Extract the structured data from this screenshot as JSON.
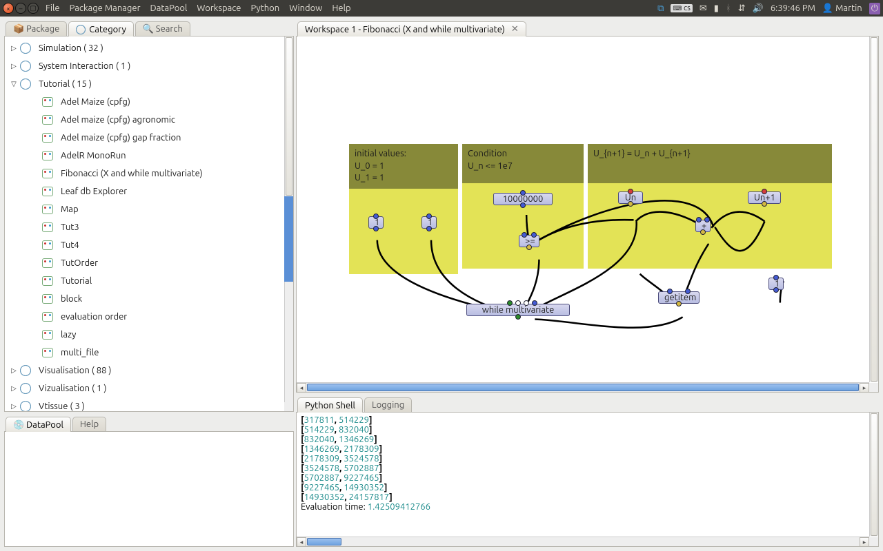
{
  "topbar": {
    "menus": [
      "File",
      "Package Manager",
      "DataPool",
      "Workspace",
      "Python",
      "Window",
      "Help"
    ],
    "clock": "6:39:46 PM",
    "user": "Martin",
    "kbd": "cs"
  },
  "left": {
    "tabs": {
      "package": "Package",
      "category": "Category",
      "search": "Search"
    },
    "tree": {
      "simulation": "Simulation ( 32 )",
      "system": "System Interaction ( 1 )",
      "tutorial": "Tutorial ( 15 )",
      "tutorial_items": [
        "Adel Maize (cpfg)",
        "Adel maize (cpfg) agronomic",
        "Adel maize (cpfg) gap fraction",
        "AdelR MonoRun",
        "Fibonacci (X and while multivariate)",
        "Leaf db Explorer",
        "Map",
        "Tut3",
        "Tut4",
        "TutOrder",
        "Tutorial",
        "block",
        "evaluation order",
        "lazy",
        "multi_file"
      ],
      "visualisation": "Visualisation ( 88 )",
      "vizualisation": "Vizualisation ( 1 )",
      "vtissue": "Vtissue ( 3 )"
    },
    "bottom_tabs": {
      "datapool": "DataPool",
      "help": "Help"
    }
  },
  "workspace": {
    "title": "Workspace 1 - Fibonacci (X and while multivariate)",
    "annotations": {
      "initial": "initial values:\nU_0 = 1\nU_1 = 1",
      "condition": "Condition\nU_n <= 1e7",
      "recur": "U_{n+1} = U_n + U_{n+1}"
    },
    "nodes": {
      "one_a": "1",
      "one_b": "1",
      "tenm": "10000000",
      "ge": ">=",
      "un": "Un",
      "un1": "Un+1",
      "plus": "+",
      "getitem": "getitem",
      "one_c": "1",
      "while": "while multivariate"
    }
  },
  "shell": {
    "tabs": {
      "python": "Python Shell",
      "logging": "Logging"
    },
    "pairs": [
      [
        "317811",
        "514229"
      ],
      [
        "514229",
        "832040"
      ],
      [
        "832040",
        "1346269"
      ],
      [
        "1346269",
        "2178309"
      ],
      [
        "2178309",
        "3524578"
      ],
      [
        "3524578",
        "5702887"
      ],
      [
        "5702887",
        "9227465"
      ],
      [
        "9227465",
        "14930352"
      ],
      [
        "14930352",
        "24157817"
      ]
    ],
    "eval_label": "Evaluation time: ",
    "eval_time": "1.42509412766"
  }
}
